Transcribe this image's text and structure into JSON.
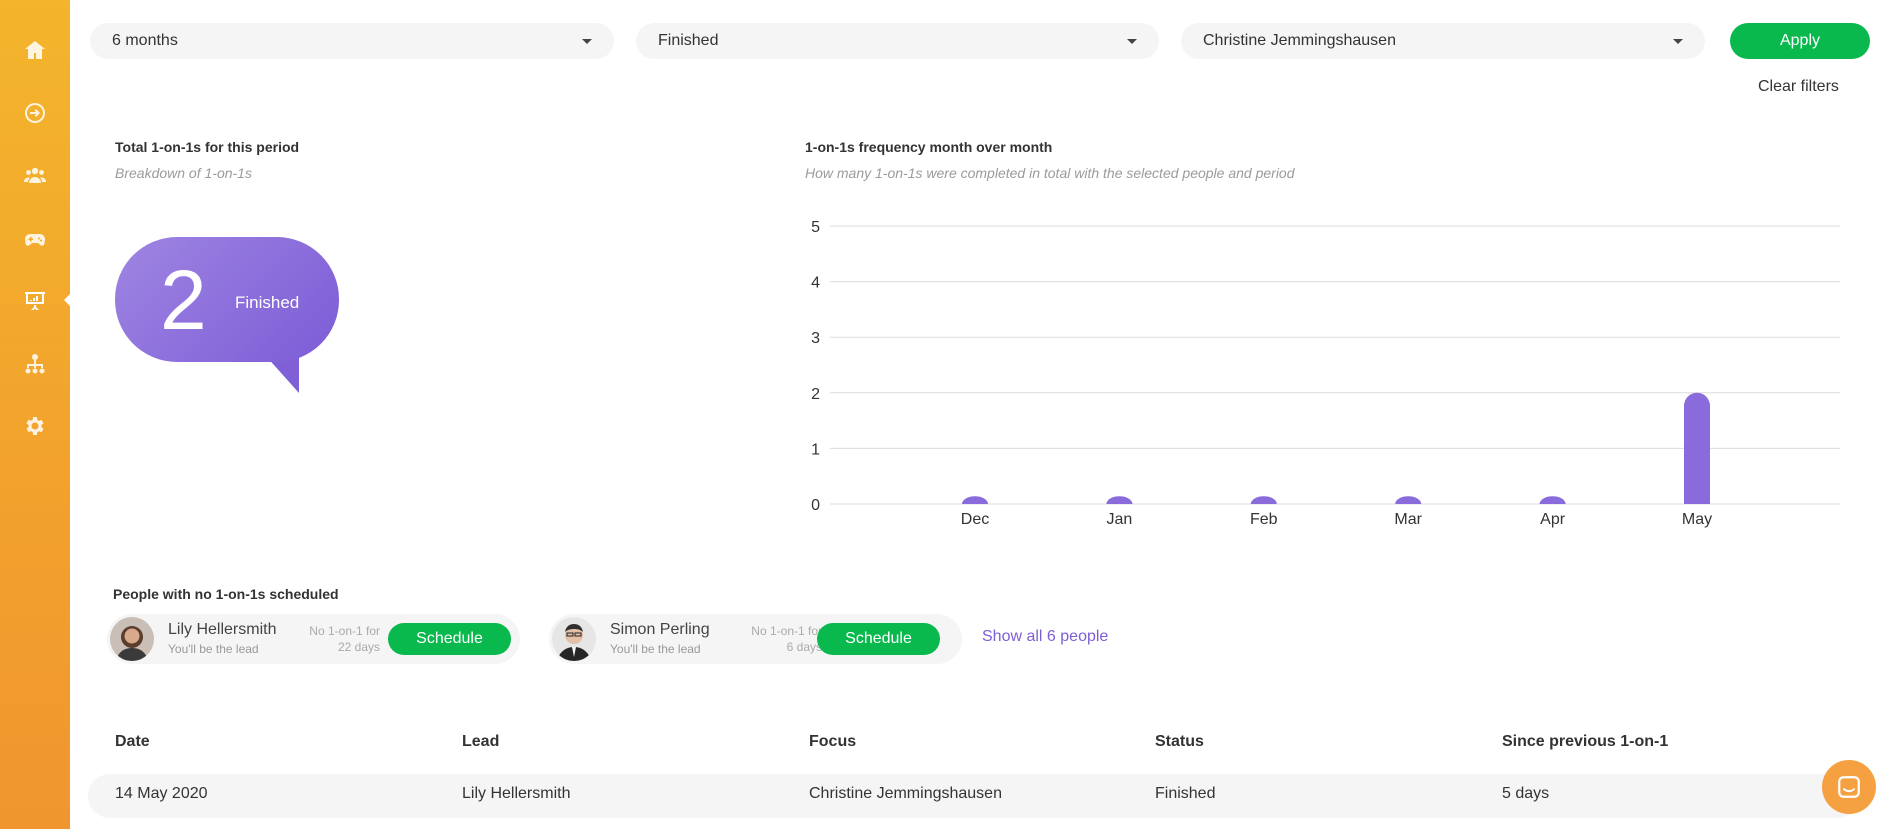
{
  "filters": {
    "period": "6 months",
    "status": "Finished",
    "person": "Christine Jemmingshausen",
    "apply_label": "Apply",
    "clear_label": "Clear filters"
  },
  "total_panel": {
    "title": "Total 1-on-1s for this period",
    "subtitle": "Breakdown of 1-on-1s",
    "count": "2",
    "count_label": "Finished"
  },
  "frequency_panel": {
    "title": "1-on-1s frequency month over month",
    "subtitle": "How many 1-on-1s were completed in total with the selected people and period"
  },
  "chart_data": {
    "type": "bar",
    "categories": [
      "Dec",
      "Jan",
      "Feb",
      "Mar",
      "Apr",
      "May"
    ],
    "values": [
      0,
      0,
      0,
      0,
      0,
      2
    ],
    "ylim": [
      0,
      5
    ],
    "yticks": [
      0,
      1,
      2,
      3,
      4,
      5
    ],
    "grid": true,
    "bar_color": "#8a6bdc"
  },
  "people_section": {
    "title": "People with no 1-on-1s scheduled",
    "people": [
      {
        "name": "Lily Hellersmith",
        "role": "You'll be the lead",
        "gap_line1": "No 1-on-1 for",
        "gap_line2": "22 days",
        "action": "Schedule"
      },
      {
        "name": "Simon Perling",
        "role": "You'll be the lead",
        "gap_line1": "No 1-on-1 for",
        "gap_line2": "6 days",
        "action": "Schedule"
      }
    ],
    "show_all_label": "Show all 6 people"
  },
  "table": {
    "headers": [
      "Date",
      "Lead",
      "Focus",
      "Status",
      "Since previous 1-on-1"
    ],
    "rows": [
      [
        "14 May 2020",
        "Lily Hellersmith",
        "Christine Jemmingshausen",
        "Finished",
        "5 days"
      ]
    ]
  },
  "colors": {
    "accent_green": "#0ab94e",
    "accent_purple": "#7d5ed6",
    "sidebar_orange": "#f2a12d"
  },
  "sidebar": {
    "items": [
      "home-icon",
      "arrow-circle-icon",
      "team-icon",
      "gamepad-icon",
      "presentation-icon",
      "org-chart-icon",
      "gear-icon"
    ]
  }
}
